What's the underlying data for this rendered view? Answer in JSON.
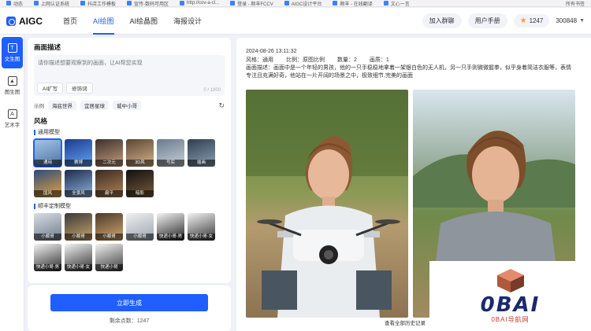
{
  "bookmarks": [
    "动态",
    "上网认证系统",
    "抖店工作模板",
    "宣传-数码可用区",
    "http://cov-a-cl...",
    "登录 - 顺丰FCCV",
    "AIGC设计平台",
    "顺丰 - 在线翻译",
    "文心一言"
  ],
  "bookmarks_right": "所有书签",
  "app": {
    "name": "AIGC",
    "nav": [
      "首页",
      "AI绘图",
      "AI绘晶图",
      "海报设计"
    ],
    "join_group": "加入群聊",
    "user_manual": "用户手册",
    "points": "1247",
    "user_id": "300848"
  },
  "rail": [
    "文生图",
    "图生图",
    "艺术字"
  ],
  "panel": {
    "desc_title": "画面描述",
    "placeholder": "请你描述想要观察到的画面，让AI帮您实现",
    "ai_expand": "AI扩写",
    "modifier": "修饰词",
    "counter": "0 / 1000",
    "examples_label": "示例",
    "examples": [
      "海底世界",
      "宜居星球",
      "城中小哥"
    ],
    "style_title": "风格",
    "group1_title": "通用模型",
    "group1": [
      "通用",
      "赛博",
      "二次元",
      "3D风",
      "写实",
      "插画",
      "国风",
      "全景风",
      "扁平",
      "暗影"
    ],
    "group2_title": "顺丰定制模型",
    "group2": [
      "小顺哥",
      "小顺哥",
      "小顺哥",
      "小顺哥",
      "快递小哥-男",
      "快递小哥-女",
      "快递小哥-男",
      "快递小哥-女",
      "快递小哥"
    ]
  },
  "generate": {
    "button": "立即生成",
    "remaining": "剩余点数：1247"
  },
  "result": {
    "timestamp": "2024-08-26 13:11:32",
    "style_label": "风格：通用",
    "ratio_label": "比例：原图比例",
    "count_label": "数量：2",
    "quality_label": "画质：1",
    "prompt": "画面描述：画面中是一个年轻的男孩，他的一只手稳稳地拿着一架银白色的无人机，另一只手则微微握拳，似乎身着简洁衣服等，表情专注且充满好奇，他站在一片开阔的场景之中，极致细节,完美的画面",
    "view_all": "查看全部历史记录"
  },
  "watermark": {
    "text": "0BAI",
    "sub": "0BAI导航网"
  }
}
